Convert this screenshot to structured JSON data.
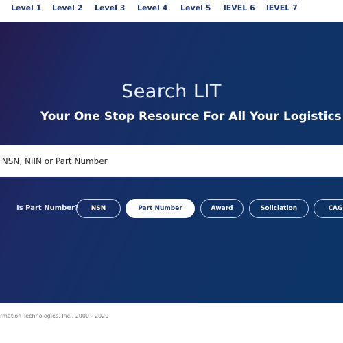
{
  "nav": {
    "items": [
      "Level 1",
      "Level 2",
      "Level 3",
      "Level 4",
      "Level 5",
      "lEVEL 6",
      "lEVEL 7"
    ]
  },
  "hero": {
    "title": "Search LIT",
    "subtitle": "Your One Stop Resource For All Your Logistics Needs"
  },
  "search": {
    "placeholder": "r NSN, NIIN or Part Number"
  },
  "filters": {
    "label": "Is Part Number?",
    "options": [
      "NSN",
      "Part Number",
      "Award",
      "Soliciation",
      "CAGE"
    ],
    "selected": "Part Number"
  },
  "footer": {
    "copyright": "rmation Technologies, Inc., 2000 - 2020"
  },
  "colors": {
    "accent": "#1f3a73",
    "hero_start": "#251b4f",
    "hero_end": "#0c3466"
  }
}
